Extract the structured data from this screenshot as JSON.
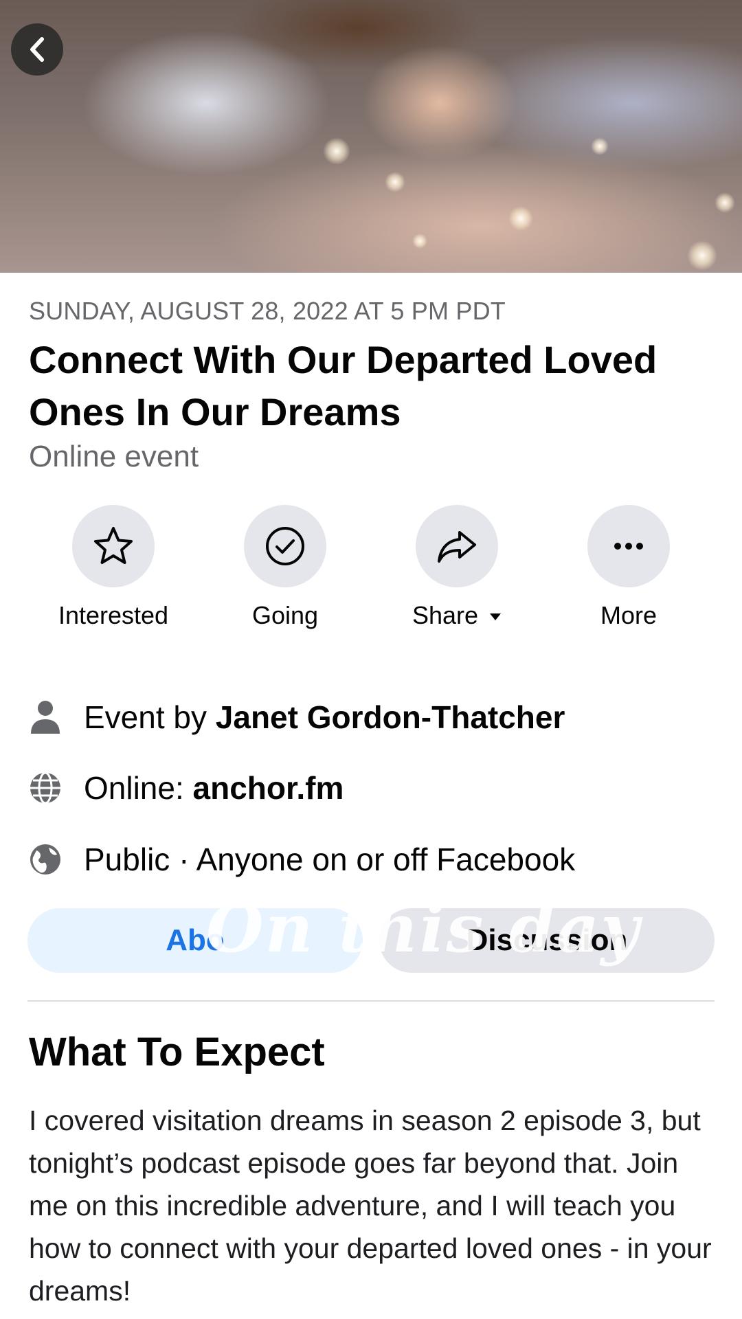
{
  "header": {
    "back_icon": "chevron-left-icon"
  },
  "event": {
    "date": "SUNDAY, AUGUST 28, 2022 AT 5 PM PDT",
    "title": "Connect With Our Departed Loved Ones In Our Dreams",
    "type": "Online event"
  },
  "actions": [
    {
      "label": "Interested",
      "icon": "star-icon"
    },
    {
      "label": "Going",
      "icon": "check-circle-icon"
    },
    {
      "label": "Share",
      "icon": "share-arrow-icon"
    },
    {
      "label": "More",
      "icon": "more-dots-icon"
    }
  ],
  "details": {
    "host_prefix": "Event by ",
    "host_name": "Janet Gordon-Thatcher",
    "online_prefix": "Online: ",
    "online_link": "anchor.fm",
    "privacy": "Public · Anyone on or off Facebook"
  },
  "tabs": {
    "about": "Abo",
    "discussion": "Discussion"
  },
  "overlay_text": "On this day",
  "about": {
    "heading": "What To Expect",
    "description": "I covered visitation dreams in season 2 episode 3, but tonight’s podcast episode goes far beyond that.  Join me on this incredible adventure, and I will teach you how to connect with your departed loved ones - in your dreams!"
  },
  "colors": {
    "accent": "#1b74e4",
    "muted_text": "#65676b",
    "button_bg": "#e4e6eb",
    "active_tab_bg": "#e7f3ff"
  }
}
